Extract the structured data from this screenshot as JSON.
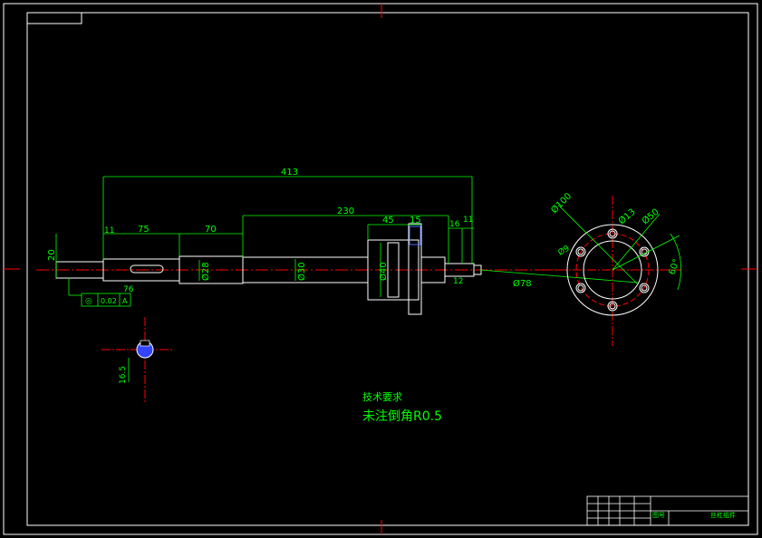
{
  "dimensions": {
    "overall": "413",
    "left_shaft": "75",
    "neck": "70",
    "body": "230",
    "flange_a": "45",
    "flange_b": "15",
    "right_small_a": "16",
    "right_small_b": "11",
    "left_small": "11",
    "left_height": "20",
    "left_dia": "Ø20",
    "neck_dia": "Ø28",
    "body_dia": "Ø30",
    "flange_dia": "Ø40",
    "pcd": "Ø100",
    "hole_dia": "Ø13",
    "outer_dia": "Ø50",
    "inner_dia": "Ø78",
    "hole_small": "Ø9",
    "angle": "60°",
    "keyway_len": "76",
    "keyway_depth": "16.5",
    "right_end": "12"
  },
  "tolerance": {
    "symbol": "◎",
    "value": "0.02",
    "datum": "A"
  },
  "notes": {
    "title": "技术要求",
    "line1": "未注倒角R0.5"
  },
  "title_block": {
    "part_name": "丝杠组件",
    "label": "图号"
  },
  "colors": {
    "outline": "#ffffff",
    "dimension": "#00ff00",
    "centerline": "#ff0000",
    "hidden": "#0000ff"
  }
}
